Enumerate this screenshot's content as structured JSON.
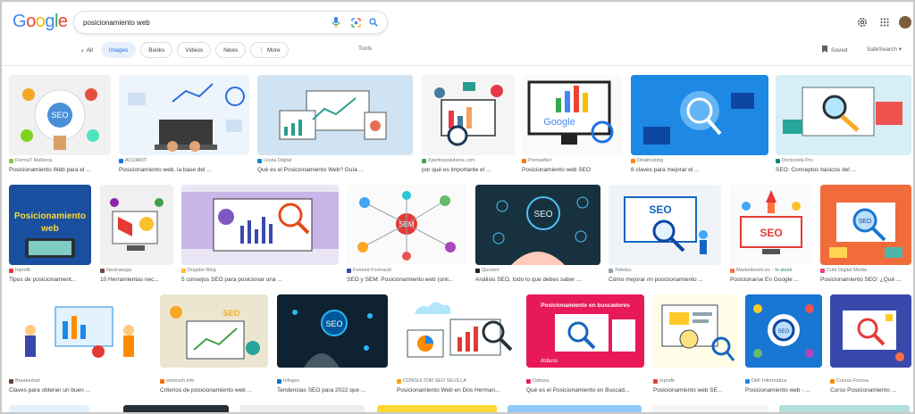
{
  "header": {
    "logo": {
      "G": "G",
      "o1": "o",
      "o2": "o",
      "g": "g",
      "l": "l",
      "e": "e"
    },
    "search_value": "posicionamiento web",
    "chips": [
      {
        "label": "All",
        "icon": "arrow-left-icon"
      },
      {
        "label": "Images",
        "active": true
      },
      {
        "label": "Books"
      },
      {
        "label": "Videos"
      },
      {
        "label": "News"
      },
      {
        "label": "More",
        "icon": "more-vert-icon"
      }
    ],
    "tools": "Tools",
    "saved": "Saved",
    "safesearch": "SafeSearch"
  },
  "results": [
    {
      "source": "FormaT Mallorca",
      "title": "Posicionamiento Web para el ..."
    },
    {
      "source": "ACUARIT",
      "title": "Posicionamiento web, la base del ..."
    },
    {
      "source": "Lluvia Digital",
      "title": "Qué es el Posicionamiento Web? Guía ..."
    },
    {
      "source": "Xpertossolutions.com",
      "title": "por qué es importante el ..."
    },
    {
      "source": "PrensaNet",
      "title": "Posicionamiento web SEO"
    },
    {
      "source": "Dinahosting",
      "title": "8 claves para mejorar el ..."
    },
    {
      "source": "Doctorella Pro",
      "title": "SEO: Conceptos básicos del ..."
    },
    {
      "source": "Inprofit",
      "title": "Tipos de posicionamient..."
    },
    {
      "source": "Nestrategia",
      "title": "10 Herramientas nec..."
    },
    {
      "source": "Doppler Blog",
      "title": "5 consejos SEO para posicionar una ..."
    },
    {
      "source": "Foment Formació",
      "title": "SEO y SEM: Posicionamiento web (onli..."
    },
    {
      "source": "Quoderi",
      "title": "Análisis SEO, todo lo que debes saber ..."
    },
    {
      "source": "Teleduc",
      "title": "Cómo mejorar mi posicionamiento ..."
    },
    {
      "source": "Marketboom.es",
      "stock": "· In stock",
      "title": "Posicionarse En Google ..."
    },
    {
      "source": "Cute Digital Media",
      "title": "Posicionamiento SEO: ¿Qué ..."
    },
    {
      "source": "Breakerlost",
      "title": "Claves para obtener un buen ..."
    },
    {
      "source": "semrush.info",
      "title": "Criterios de posicionamiento web ..."
    },
    {
      "source": "Infoges",
      "title": "Tendencias SEO para 2022 que ..."
    },
    {
      "source": "CONSULTOR SEO SEVILLA",
      "title": "Posicionamiento Web en Dos Herman..."
    },
    {
      "source": "Dobuss",
      "title": "Qué es el Posicionamiento en Buscad..."
    },
    {
      "source": "Inprofit",
      "title": "Posicionamiento web SE..."
    },
    {
      "source": "DbF Informática",
      "title": "Posicionamiento web - ..."
    },
    {
      "source": "Cursos Femxa",
      "title": "Curso Posicionamiento ..."
    }
  ],
  "thumb_text": {
    "seo1": "SEO",
    "google": "Google",
    "posweb1": "Posicionamiento",
    "posweb2": "web",
    "seo_teleduc": "SEO",
    "seo_market": "SEO",
    "seo_quoderi": "SEO",
    "seo_cute": "SEO",
    "seo_semrush": "SEO",
    "seo_infoges": "SEO",
    "seo_dbf": "SEO",
    "sem": "SEM",
    "dobuss_title": "Posicionamiento en buscadores",
    "dobuss_logo": "dobuss"
  },
  "colors": {
    "accent": "#1a73e8",
    "chip_active_bg": "#e8f0fe",
    "text_muted": "#70757a"
  }
}
